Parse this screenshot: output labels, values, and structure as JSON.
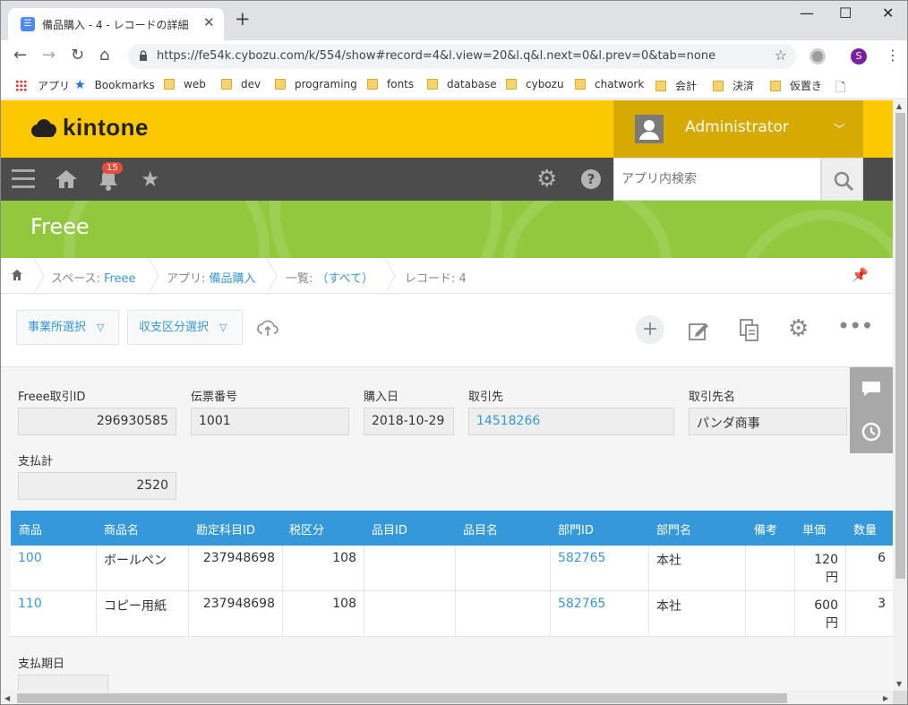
{
  "browser": {
    "tab_title": "備品購入 - 4 - レコードの詳細",
    "url": "https://fe54k.cybozu.com/k/554/show#record=4&l.view=20&l.q&l.next=0&l.prev=0&tab=none",
    "profile_initial": "S",
    "window_controls": {
      "minimize": "—",
      "maximize": "☐",
      "close": "✕"
    },
    "bookmarks": [
      "アプリ",
      "Bookmarks",
      "web",
      "dev",
      "programing",
      "fonts",
      "database",
      "cybozu",
      "chatwork",
      "会計",
      "決済",
      "仮置き"
    ]
  },
  "header": {
    "logo_text": "kintone",
    "user_name": "Administrator"
  },
  "nav": {
    "notification_count": "15",
    "search_placeholder": "アプリ内検索"
  },
  "space": {
    "title": "Freee"
  },
  "breadcrumb": {
    "space_label": "スペース: ",
    "space_name": "Freee",
    "app_label": "アプリ: ",
    "app_name": "備品購入",
    "list_label": "一覧: ",
    "list_name": "（すべて）",
    "record_label": "レコード: 4"
  },
  "actions": {
    "office_select": "事業所選択",
    "balance_select": "収支区分選択"
  },
  "fields": {
    "freee_id": {
      "label": "Freee取引ID",
      "value": "296930585"
    },
    "slip_no": {
      "label": "伝票番号",
      "value": "1001"
    },
    "purchase_date": {
      "label": "購入日",
      "value": "2018-10-29"
    },
    "partner": {
      "label": "取引先",
      "value": "14518266"
    },
    "partner_name": {
      "label": "取引先名",
      "value": "パンダ商事"
    },
    "total": {
      "label": "支払計",
      "value": "2520"
    },
    "due_date": {
      "label": "支払期日",
      "value": ""
    }
  },
  "table": {
    "columns": [
      "商品",
      "商品名",
      "勘定科目ID",
      "税区分",
      "品目ID",
      "品目名",
      "部門ID",
      "部門名",
      "備考",
      "単価",
      "数量"
    ],
    "rows": [
      {
        "item": "100",
        "item_name": "ボールペン",
        "account_id": "237948698",
        "tax": "108",
        "product_id": "",
        "product_name": "",
        "dept_id": "582765",
        "dept_name": "本社",
        "note": "",
        "price": "120",
        "price_unit": "円",
        "qty": "6"
      },
      {
        "item": "110",
        "item_name": "コピー用紙",
        "account_id": "237948698",
        "tax": "108",
        "product_id": "",
        "product_name": "",
        "dept_id": "582765",
        "dept_name": "本社",
        "note": "",
        "price": "600",
        "price_unit": "円",
        "qty": "3"
      }
    ]
  }
}
